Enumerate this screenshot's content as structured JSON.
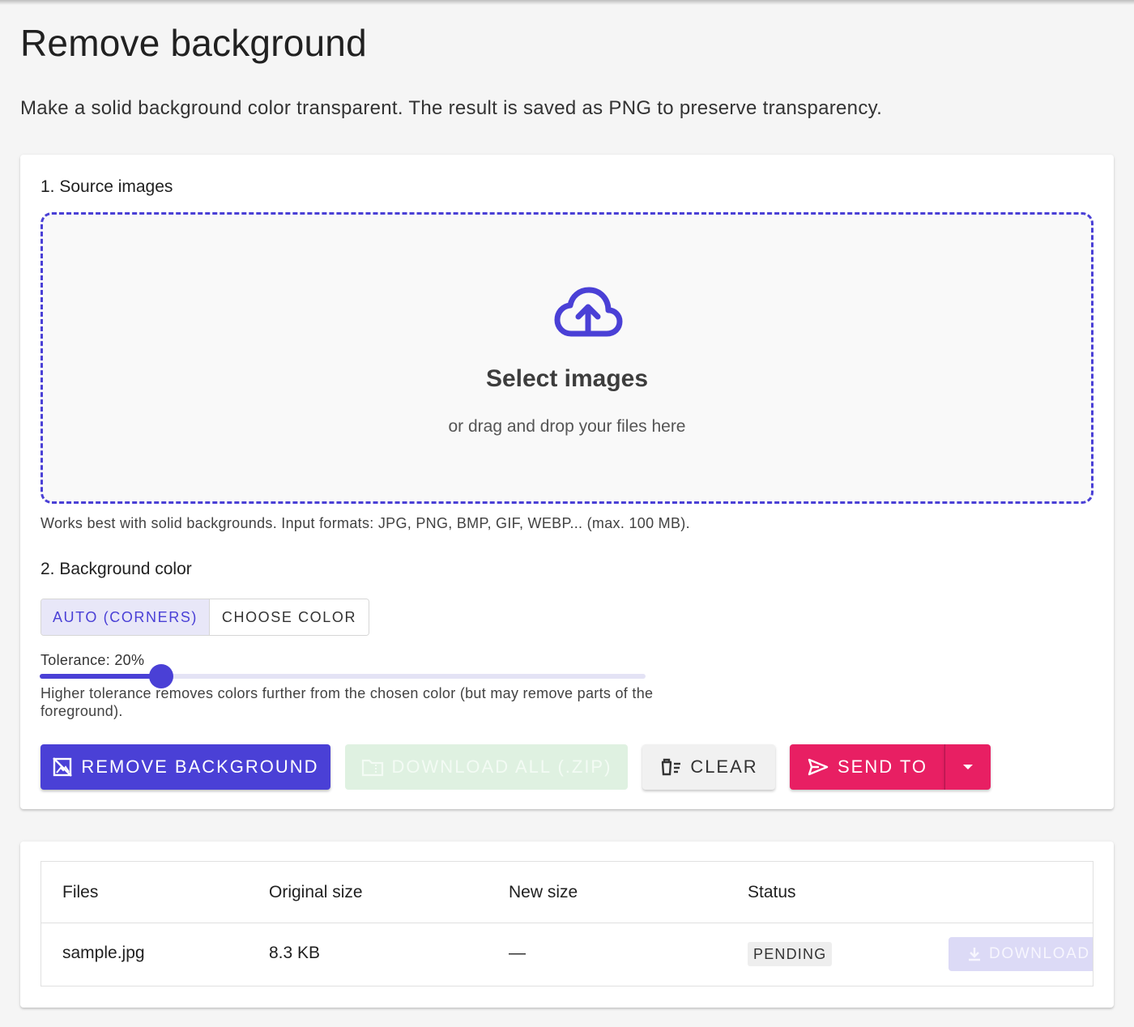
{
  "page": {
    "title": "Remove background",
    "description": "Make a solid background color transparent. The result is saved as PNG to preserve transparency."
  },
  "source": {
    "section_title": "1. Source images",
    "dropzone_title": "Select images",
    "dropzone_subtitle": "or drag and drop your files here",
    "dropzone_icon": "cloud-upload-icon",
    "hint": "Works best with solid backgrounds. Input formats: JPG, PNG, BMP, GIF, WEBP... (max. 100 MB)."
  },
  "background": {
    "section_title": "2. Background color",
    "modes": [
      "AUTO (CORNERS)",
      "CHOOSE COLOR"
    ],
    "selected_mode": "AUTO (CORNERS)",
    "tolerance_label": "Tolerance: 20%",
    "tolerance_value": 20,
    "tolerance_max": 100,
    "tolerance_help": "Higher tolerance removes colors further from the chosen color (but may remove parts of the foreground)."
  },
  "actions": {
    "remove_label": "REMOVE BACKGROUND",
    "download_all_label": "DOWNLOAD ALL (.ZIP)",
    "clear_label": "CLEAR",
    "send_label": "SEND TO",
    "icons": {
      "remove": "image-off-icon",
      "download_all": "folder-zip-icon",
      "clear": "delete-sweep-icon",
      "send": "send-icon",
      "menu": "caret-down-icon"
    }
  },
  "table": {
    "headers": [
      "Files",
      "Original size",
      "New size",
      "Status"
    ],
    "rows": [
      {
        "file": "sample.jpg",
        "original_size": "8.3 KB",
        "new_size": "—",
        "status": "PENDING",
        "action_label": "DOWNLOAD"
      }
    ]
  },
  "colors": {
    "primary": "#4a40d6",
    "send": "#e81f63",
    "download_all_disabled": "#dff1e1",
    "row_download_disabled": "#dcdaf6"
  }
}
